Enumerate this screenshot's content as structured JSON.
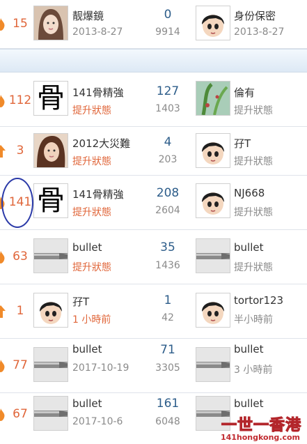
{
  "rows": [
    {
      "count": "15",
      "author": "靓爆鏡",
      "date": "2013-8-27",
      "replies": "0",
      "views": "9914",
      "last_user": "身份保密",
      "last_time": "2013-8-27"
    },
    {
      "count": "112",
      "author": "141骨精強",
      "date": "提升狀態",
      "replies": "127",
      "views": "1403",
      "last_user": "倫有",
      "last_time": "提升狀態"
    },
    {
      "count": "3",
      "author": "2012大災難",
      "date": "提升狀態",
      "replies": "4",
      "views": "203",
      "last_user": "孖T",
      "last_time": "提升狀態"
    },
    {
      "count": "141",
      "author": "141骨精強",
      "date": "提升狀態",
      "replies": "208",
      "views": "2604",
      "last_user": "NJ668",
      "last_time": "提升狀態"
    },
    {
      "count": "63",
      "author": "bullet",
      "date": "提升狀態",
      "replies": "35",
      "views": "1436",
      "last_user": "bullet",
      "last_time": "提升狀態"
    },
    {
      "count": "1",
      "author": "孖T",
      "date": "1 小時前",
      "replies": "1",
      "views": "42",
      "last_user": "tortor123",
      "last_time": "半小時前"
    },
    {
      "count": "77",
      "author": "bullet",
      "date": "2017-10-19",
      "replies": "71",
      "views": "3305",
      "last_user": "bullet",
      "last_time": "3 小時前"
    },
    {
      "count": "67",
      "author": "bullet",
      "date": "2017-10-6",
      "replies": "161",
      "views": "6048",
      "last_user": "bullet",
      "last_time": ""
    }
  ],
  "avatar_glyph": "骨",
  "watermark": {
    "main": "一世一香港",
    "url": "141hongkong.com"
  },
  "colors": {
    "accent_red": "#e0663a",
    "number_blue": "#2d5d8a",
    "circle_blue": "#2b3aa8"
  }
}
